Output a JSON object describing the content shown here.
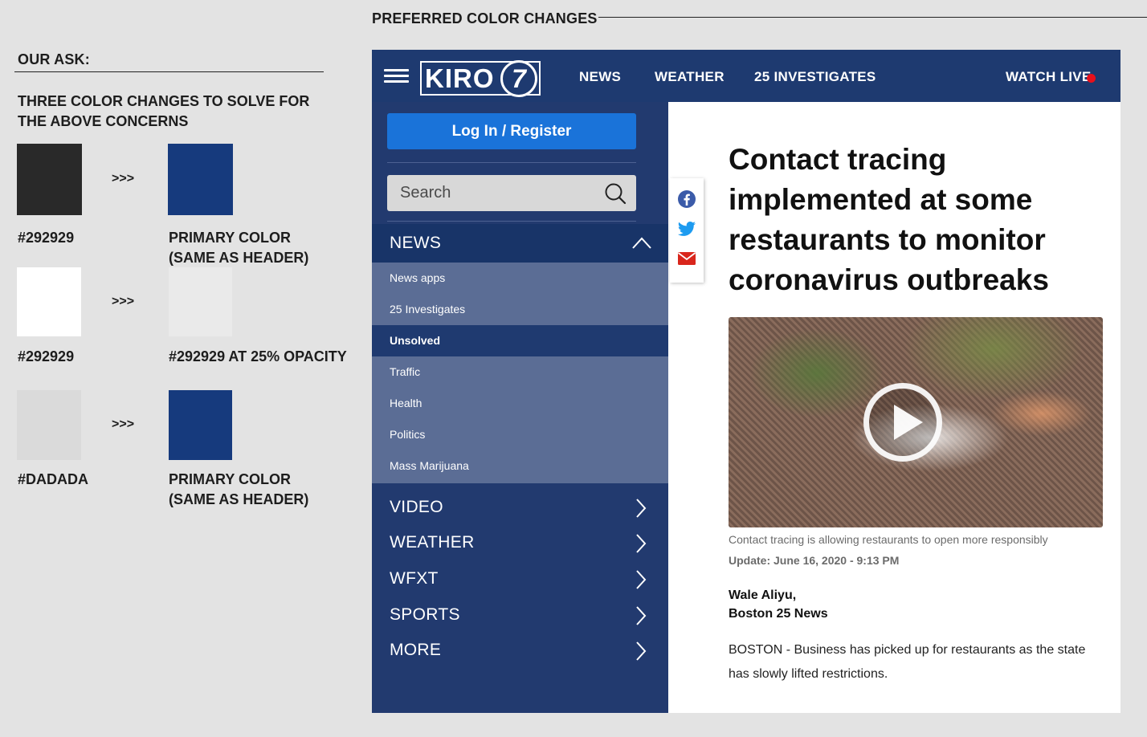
{
  "annotations": {
    "section_title": "PREFERRED COLOR CHANGES",
    "ask_title": "OUR ASK:",
    "ask_description": "THREE COLOR CHANGES TO SOLVE FOR THE ABOVE CONCERNS",
    "arrow": ">>>",
    "swaps": [
      {
        "from_color": "#292929",
        "from_label": "#292929",
        "to_color": "#163a7d",
        "to_label_1": "PRIMARY COLOR",
        "to_label_2": "(SAME AS HEADER)"
      },
      {
        "from_color": "#ffffff",
        "from_label": "#292929",
        "to_color": "#eaeaea",
        "to_label_1": "#292929 AT 25% OPACITY",
        "to_label_2": ""
      },
      {
        "from_color": "#dadada",
        "from_label": "#DADADA",
        "to_color": "#163a7d",
        "to_label_1": "PRIMARY COLOR",
        "to_label_2": "(SAME AS HEADER)"
      }
    ]
  },
  "site": {
    "colors": {
      "primary": "#1e3a70",
      "login": "#1a73d9",
      "live_dot": "#e8101b"
    },
    "header": {
      "logo_text": "KIRO",
      "logo_number": "7",
      "nav": [
        "NEWS",
        "WEATHER",
        "25 INVESTIGATES"
      ],
      "watch_live": "WATCH LIVE"
    },
    "sidebar": {
      "login_label": "Log In / Register",
      "search_placeholder": "Search",
      "news_label": "NEWS",
      "news_subitems": [
        "News apps",
        "25 Investigates",
        "Unsolved",
        "Traffic",
        "Health",
        "Politics",
        "Mass Marijuana"
      ],
      "active_subitem": "Unsolved",
      "main_items": [
        "VIDEO",
        "WEATHER",
        "WFXT",
        "SPORTS",
        "MORE"
      ]
    },
    "share_icons": [
      "facebook-icon",
      "twitter-icon",
      "email-icon"
    ],
    "article": {
      "headline": "Contact tracing implemented at some restaurants to monitor coronavirus outbreaks",
      "caption": "Contact tracing is allowing restaurants to open more responsibly",
      "update": "Update: June 16, 2020 - 9:13 PM",
      "author": "Wale Aliyu,",
      "outlet": "Boston 25 News",
      "body": "BOSTON - Business has picked up for restaurants as the state has slowly lifted restrictions."
    }
  }
}
